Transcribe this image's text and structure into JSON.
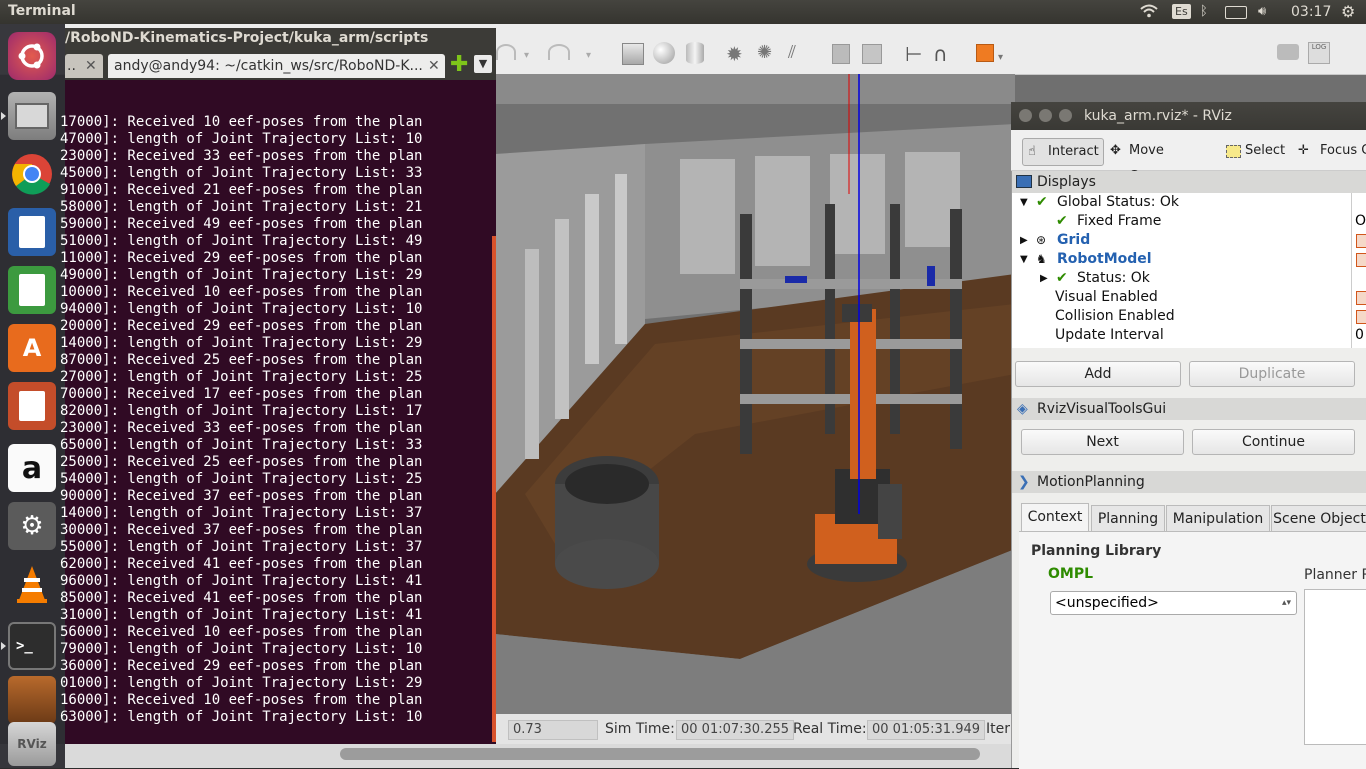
{
  "top_panel": {
    "title": "Terminal",
    "keyboard_layout": "Es",
    "time": "03:17"
  },
  "terminal": {
    "window_title": "/RoboND-Kinematics-Project/kuka_arm/scripts",
    "tab_partial": "..",
    "tab_active": "andy@andy94: ~/catkin_ws/src/RoboND-K...",
    "lines": [
      "17000]: Received 10 eef-poses from the plan",
      "47000]: length of Joint Trajectory List: 10",
      "23000]: Received 33 eef-poses from the plan",
      "45000]: length of Joint Trajectory List: 33",
      "91000]: Received 21 eef-poses from the plan",
      "58000]: length of Joint Trajectory List: 21",
      "59000]: Received 49 eef-poses from the plan",
      "51000]: length of Joint Trajectory List: 49",
      "11000]: Received 29 eef-poses from the plan",
      "49000]: length of Joint Trajectory List: 29",
      "10000]: Received 10 eef-poses from the plan",
      "94000]: length of Joint Trajectory List: 10",
      "20000]: Received 29 eef-poses from the plan",
      "14000]: length of Joint Trajectory List: 29",
      "87000]: Received 25 eef-poses from the plan",
      "27000]: length of Joint Trajectory List: 25",
      "70000]: Received 17 eef-poses from the plan",
      "82000]: length of Joint Trajectory List: 17",
      "23000]: Received 33 eef-poses from the plan",
      "65000]: length of Joint Trajectory List: 33",
      "25000]: Received 25 eef-poses from the plan",
      "54000]: length of Joint Trajectory List: 25",
      "90000]: Received 37 eef-poses from the plan",
      "14000]: length of Joint Trajectory List: 37",
      "30000]: Received 37 eef-poses from the plan",
      "55000]: length of Joint Trajectory List: 37",
      "62000]: Received 41 eef-poses from the plan",
      "96000]: length of Joint Trajectory List: 41",
      "85000]: Received 41 eef-poses from the plan",
      "31000]: length of Joint Trajectory List: 41",
      "56000]: Received 10 eef-poses from the plan",
      "79000]: length of Joint Trajectory List: 10",
      "36000]: Received 29 eef-poses from the plan",
      "01000]: length of Joint Trajectory List: 29",
      "16000]: Received 10 eef-poses from the plan",
      "63000]: length of Joint Trajectory List: 10"
    ]
  },
  "gazebo": {
    "real_time_factor": "0.73",
    "sim_time_label": "Sim Time:",
    "sim_time": "00 01:07:30.255",
    "real_time_label": "Real Time:",
    "real_time": "00 01:05:31.949",
    "iterations_label": "Iter"
  },
  "rviz": {
    "window_title": "kuka_arm.rviz* - RViz",
    "tools": [
      "Interact",
      "Move Camera",
      "Select",
      "Focus Ca"
    ],
    "displays_title": "Displays",
    "tree": {
      "global_status": "Global Status: Ok",
      "fixed_frame": "Fixed Frame",
      "grid": "Grid",
      "robot_model": "RobotModel",
      "status": "Status: Ok",
      "visual_enabled": "Visual Enabled",
      "collision_enabled": "Collision Enabled",
      "update_interval": "Update Interval",
      "update_interval_value": "0",
      "fixed_frame_value": "O"
    },
    "buttons": {
      "add": "Add",
      "duplicate": "Duplicate",
      "next": "Next",
      "continue": "Continue"
    },
    "visual_tools_title": "RvizVisualToolsGui",
    "motion_planning_title": "MotionPlanning",
    "mp_tabs": [
      "Context",
      "Planning",
      "Manipulation",
      "Scene Object"
    ],
    "planning_library": "Planning Library",
    "ompl": "OMPL",
    "planner_select": "<unspecified>",
    "planner_params": "Planner P"
  }
}
